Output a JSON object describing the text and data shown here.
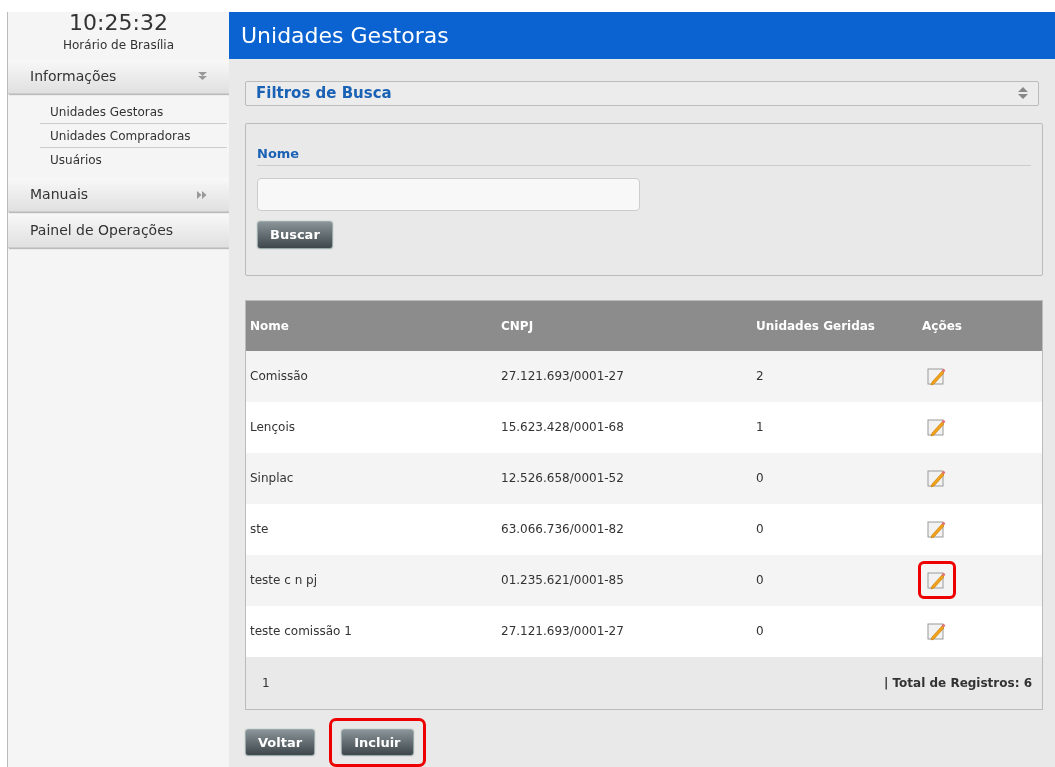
{
  "clock": {
    "time": "10:25:32",
    "zone": "Horário de Brasília"
  },
  "sidebar": [
    {
      "label": "Informações",
      "kind": "group",
      "expanded": true,
      "children": [
        {
          "label": "Unidades Gestoras"
        },
        {
          "label": "Unidades Compradoras"
        },
        {
          "label": "Usuários"
        }
      ]
    },
    {
      "label": "Manuais",
      "kind": "group",
      "expanded": false
    },
    {
      "label": "Painel de Operações",
      "kind": "link"
    }
  ],
  "page_title": "Unidades Gestoras",
  "filters": {
    "title": "Filtros de Busca",
    "field_label": "Nome",
    "search_button": "Buscar"
  },
  "table": {
    "columns": [
      "Nome",
      "CNPJ",
      "Unidades Geridas",
      "Ações"
    ],
    "rows": [
      {
        "name": "Comissão",
        "cnpj": "27.121.693/0001-27",
        "count": "2",
        "highlighted": false
      },
      {
        "name": "Lençois",
        "cnpj": "15.623.428/0001-68",
        "count": "1",
        "highlighted": false
      },
      {
        "name": "Sinplac",
        "cnpj": "12.526.658/0001-52",
        "count": "0",
        "highlighted": false
      },
      {
        "name": "ste",
        "cnpj": "63.066.736/0001-82",
        "count": "0",
        "highlighted": false
      },
      {
        "name": "teste c n pj",
        "cnpj": "01.235.621/0001-85",
        "count": "0",
        "highlighted": true
      },
      {
        "name": "teste comissão 1",
        "cnpj": "27.121.693/0001-27",
        "count": "0",
        "highlighted": false
      }
    ],
    "page": "1",
    "total": "| Total de Registros: 6"
  },
  "buttons": [
    {
      "label": "Voltar",
      "highlighted": false
    },
    {
      "label": "Incluir",
      "highlighted": true
    }
  ]
}
